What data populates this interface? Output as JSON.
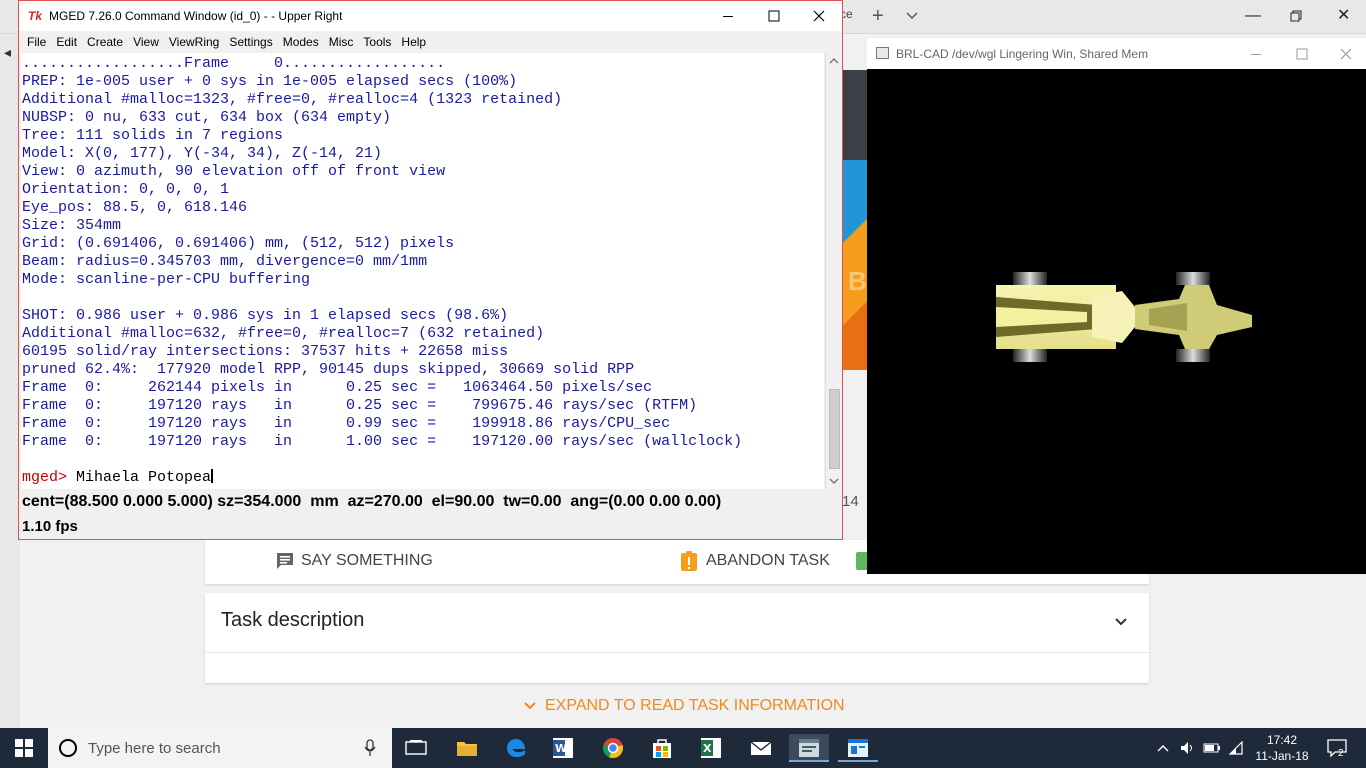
{
  "browser": {
    "tab_fragment": "rce",
    "orange_letter": "B",
    "left_number": "14"
  },
  "task": {
    "say_something": "SAY SOMETHING",
    "abandon_task": "ABANDON TASK",
    "description_title": "Task description",
    "expand_label": "EXPAND TO READ TASK INFORMATION",
    "accent_color": "#f08a1c"
  },
  "mged": {
    "title": "MGED 7.26.0 Command Window (id_0) -  - Upper Right",
    "logo": "Tk",
    "menu": [
      "File",
      "Edit",
      "Create",
      "View",
      "ViewRing",
      "Settings",
      "Modes",
      "Misc",
      "Tools",
      "Help"
    ],
    "console_lines": [
      "..................Frame     0..................",
      "PREP: 1e-005 user + 0 sys in 1e-005 elapsed secs (100%)",
      "Additional #malloc=1323, #free=0, #realloc=4 (1323 retained)",
      "NUBSP: 0 nu, 633 cut, 634 box (634 empty)",
      "Tree: 111 solids in 7 regions",
      "Model: X(0, 177), Y(-34, 34), Z(-14, 21)",
      "View: 0 azimuth, 90 elevation off of front view",
      "Orientation: 0, 0, 0, 1",
      "Eye_pos: 88.5, 0, 618.146",
      "Size: 354mm",
      "Grid: (0.691406, 0.691406) mm, (512, 512) pixels",
      "Beam: radius=0.345703 mm, divergence=0 mm/1mm",
      "Mode: scanline-per-CPU buffering",
      "",
      "SHOT: 0.986 user + 0.986 sys in 1 elapsed secs (98.6%)",
      "Additional #malloc=632, #free=0, #realloc=7 (632 retained)",
      "60195 solid/ray intersections: 37537 hits + 22658 miss",
      "pruned 62.4%:  177920 model RPP, 90145 dups skipped, 30669 solid RPP",
      "Frame  0:     262144 pixels in      0.25 sec =   1063464.50 pixels/sec",
      "Frame  0:     197120 rays   in      0.25 sec =    799675.46 rays/sec (RTFM)",
      "Frame  0:     197120 rays   in      0.99 sec =    199918.86 rays/CPU_sec",
      "Frame  0:     197120 rays   in      1.00 sec =    197120.00 rays/sec (wallclock)",
      ""
    ],
    "prompt": "mged>",
    "command_input": "Mihaela Potopea",
    "status_line": "cent=(88.500 0.000 5.000) sz=354.000  mm  az=270.00  el=90.00  tw=0.00  ang=(0.00 0.00 0.00)",
    "fps": "1.10 fps",
    "text_color": "#1a1aa0",
    "prompt_color": "#c00000"
  },
  "graphics": {
    "title": "BRL-CAD /dev/wgl Lingering Win, Shared Mem",
    "model_color": "#f4f0a0"
  },
  "taskbar": {
    "search_placeholder": "Type here to search",
    "time": "17:42",
    "date": "11-Jan-18",
    "notifications": "2"
  }
}
